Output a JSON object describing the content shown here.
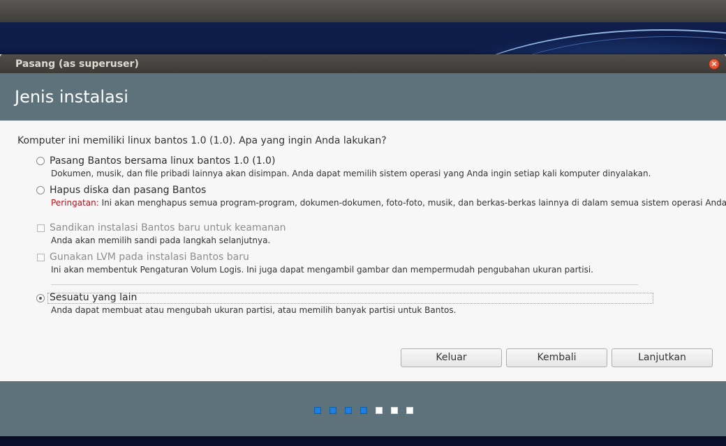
{
  "window": {
    "title": "Pasang (as superuser)"
  },
  "header": {
    "title": "Jenis instalasi"
  },
  "question": "Komputer ini memiliki linux bantos 1.0 (1.0). Apa yang ingin Anda lakukan?",
  "options": [
    {
      "label": "Pasang Bantos bersama linux bantos 1.0 (1.0)",
      "desc": "Dokumen, musik, dan file pribadi lainnya akan disimpan. Anda dapat memilih sistem operasi yang Anda ingin setiap kali komputer dinyalakan."
    },
    {
      "label": "Hapus diska dan pasang Bantos",
      "warn": "Peringatan:",
      "desc": " Ini akan menghapus semua program-program, dokumen-dokumen, foto-foto, musik, dan berkas-berkas lainnya di dalam semua sistem operasi Anda."
    },
    {
      "label": "Sandikan instalasi Bantos baru untuk keamanan",
      "desc": "Anda akan memilih sandi pada langkah selanjutnya."
    },
    {
      "label": "Gunakan LVM pada instalasi Bantos baru",
      "desc": "Ini akan membentuk Pengaturan Volum Logis. Ini juga dapat mengambil gambar dan mempermudah pengubahan ukuran partisi."
    },
    {
      "label": "Sesuatu yang lain",
      "desc": "Anda dapat membuat atau mengubah ukuran partisi, atau memilih banyak partisi untuk Bantos."
    }
  ],
  "selected_option": "Sesuatu yang lain",
  "buttons": {
    "quit": "Keluar",
    "back": "Kembali",
    "continue": "Lanjutkan"
  },
  "progress": {
    "total_steps": 7,
    "completed_steps": 4
  },
  "colors": {
    "accent_band": "#5d727b",
    "progress_filled": "#1f7fe0",
    "warning": "#b3121b"
  }
}
